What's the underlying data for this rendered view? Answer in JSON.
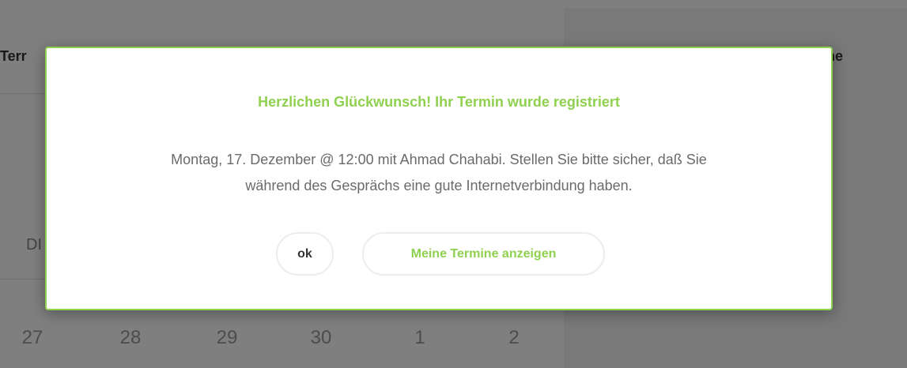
{
  "background": {
    "heading_left": "Terr",
    "heading_right": "ine",
    "weekday_label": "DI",
    "calendar_days": [
      "27",
      "28",
      "29",
      "30",
      "1",
      "2"
    ]
  },
  "modal": {
    "title": "Herzlichen Glückwunsch! Ihr Termin wurde registriert",
    "message_line1": "Montag, 17. Dezember @ 12:00 mit Ahmad Chahabi. Stellen Sie bitte sicher, daß Sie",
    "message_line2": "während des Gesprächs eine gute Internetverbindung haben.",
    "ok_label": "ok",
    "view_appointments_label": "Meine Termine anzeigen"
  },
  "colors": {
    "accent": "#8fd14f",
    "text_muted": "#6a6a6a",
    "overlay": "rgba(0,0,0,0.5)"
  }
}
